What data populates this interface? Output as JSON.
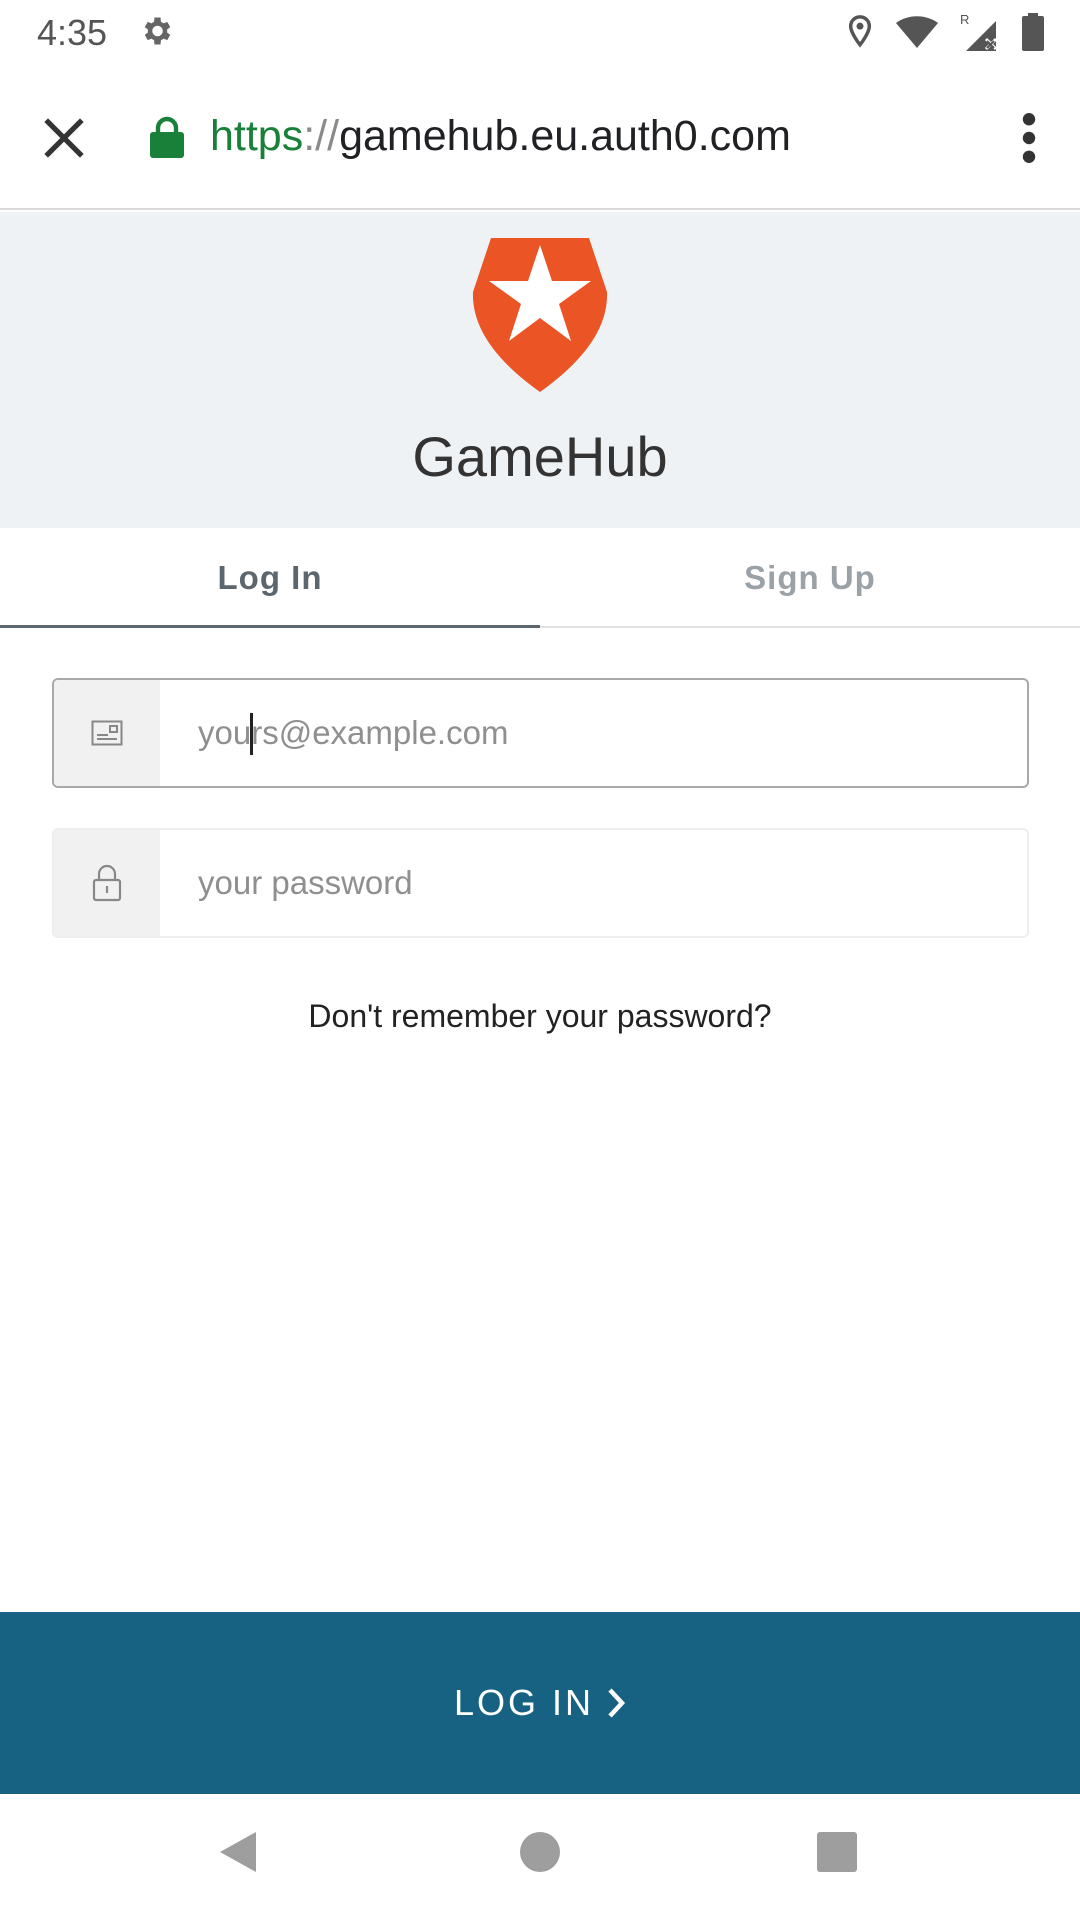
{
  "status_bar": {
    "time": "4:35",
    "icons": [
      "settings-gear-icon",
      "location-pin-icon",
      "wifi-icon",
      "cell-signal-roaming-icon",
      "battery-icon"
    ],
    "roaming_label": "R"
  },
  "browser": {
    "url_scheme": "https",
    "url_separator": "://",
    "url_host": "gamehub.eu.auth0.com",
    "close_icon": "close-icon",
    "lock_icon": "lock-icon",
    "menu_icon": "more-vert-icon",
    "colors": {
      "scheme": "#188038",
      "lock": "#188038"
    }
  },
  "header": {
    "app_name": "GameHub",
    "logo_icon": "auth0-shield-star-logo",
    "logo_color": "#eb5424",
    "background": "#eef2f4"
  },
  "tabs": [
    {
      "label": "Log In",
      "active": true
    },
    {
      "label": "Sign Up",
      "active": false
    }
  ],
  "form": {
    "email": {
      "placeholder": "yours@example.com",
      "value": "",
      "icon": "email-card-icon",
      "focused": true
    },
    "password": {
      "placeholder": "your password",
      "value": "",
      "icon": "padlock-icon",
      "focused": false
    },
    "forgot_label": "Don't remember your password?",
    "submit_label": "LOG IN",
    "submit_icon": "chevron-right-icon",
    "submit_color": "#176282"
  },
  "nav_bar": {
    "icons": [
      "back-triangle-icon",
      "home-circle-icon",
      "recents-square-icon"
    ]
  }
}
